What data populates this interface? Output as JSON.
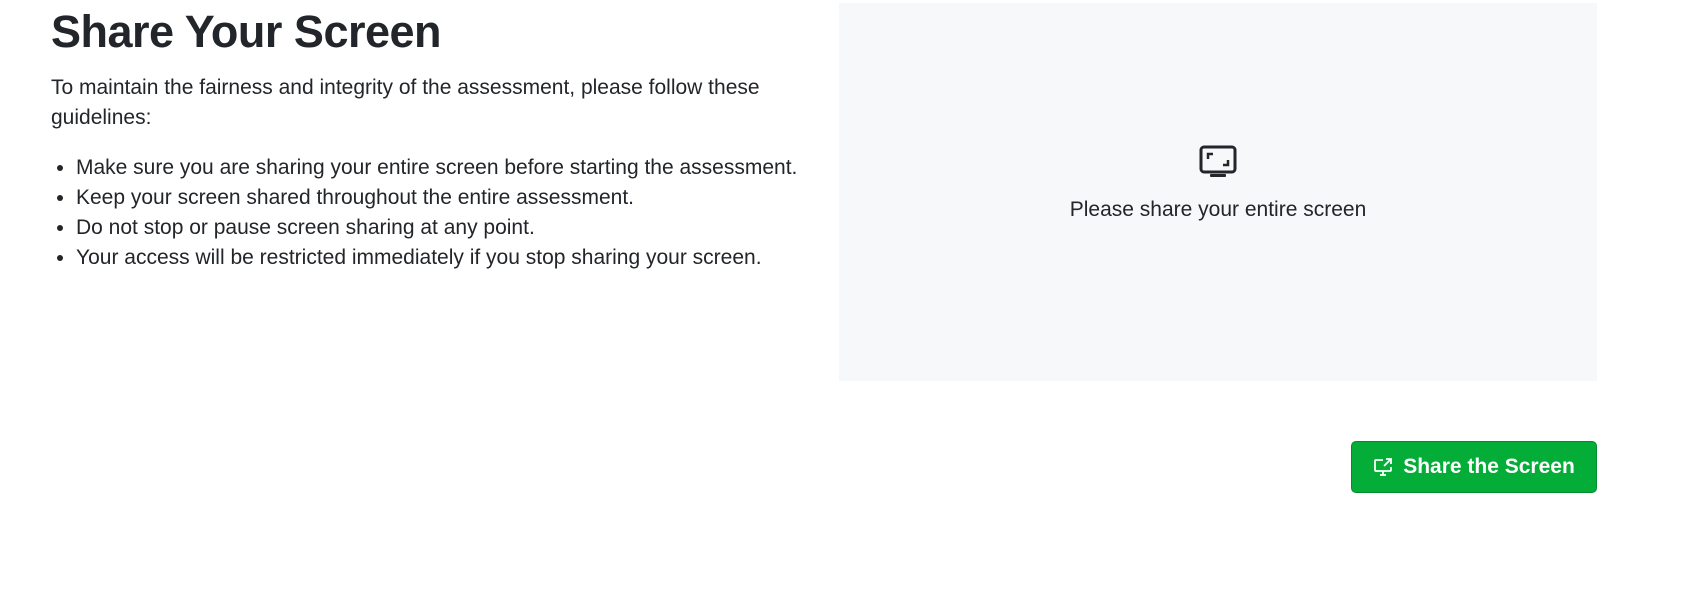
{
  "page": {
    "title": "Share Your Screen",
    "intro": "To maintain the fairness and integrity of the assessment, please follow these guidelines:",
    "guidelines": [
      "Make sure you are sharing your entire screen before starting the assessment.",
      "Keep your screen shared throughout the entire assessment.",
      "Do not stop or pause screen sharing at any point.",
      "Your access will be restricted immediately if you stop sharing your screen."
    ]
  },
  "preview": {
    "icon": "fullscreen-monitor-icon",
    "message": "Please share your entire screen"
  },
  "actions": {
    "share_label": "Share the Screen",
    "share_icon": "screen-share-icon"
  },
  "colors": {
    "accent": "#04ac38",
    "text": "#222529",
    "panel_bg": "#f7f8f9"
  }
}
